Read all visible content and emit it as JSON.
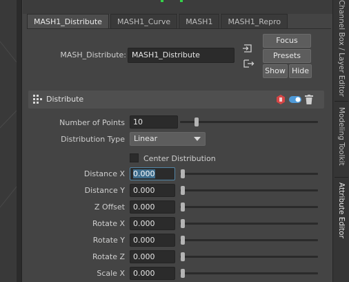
{
  "side_tabs": [
    "Channel Box / Layer Editor",
    "Modeling Toolkit",
    "Attribute Editor"
  ],
  "tabs": [
    {
      "label": "MASH1_Distribute",
      "active": true
    },
    {
      "label": "MASH1_Curve",
      "active": false
    },
    {
      "label": "MASH1",
      "active": false
    },
    {
      "label": "MASH1_Repro",
      "active": false
    }
  ],
  "node": {
    "label": "MASH_Distribute:",
    "value": "MASH1_Distribute"
  },
  "buttons": {
    "focus": "Focus",
    "presets": "Presets",
    "show": "Show",
    "hide": "Hide"
  },
  "section": {
    "title": "Distribute"
  },
  "fields": {
    "number_of_points": {
      "label": "Number of Points",
      "value": "10"
    },
    "distribution_type": {
      "label": "Distribution Type",
      "value": "Linear"
    },
    "center_distribution": {
      "label": "Center Distribution",
      "checked": false
    },
    "distance_x": {
      "label": "Distance X",
      "value": "0.000"
    },
    "distance_y": {
      "label": "Distance Y",
      "value": "0.000"
    },
    "z_offset": {
      "label": "Z Offset",
      "value": "0.000"
    },
    "rotate_x": {
      "label": "Rotate X",
      "value": "0.000"
    },
    "rotate_y": {
      "label": "Rotate Y",
      "value": "0.000"
    },
    "rotate_z": {
      "label": "Rotate Z",
      "value": "0.000"
    },
    "scale_x": {
      "label": "Scale X",
      "value": "0.000"
    }
  },
  "colors": {
    "accent": "#5285a6",
    "toggle": "#4f9ad8",
    "node_icon": "#d64646",
    "indicator": "#35d24a"
  }
}
